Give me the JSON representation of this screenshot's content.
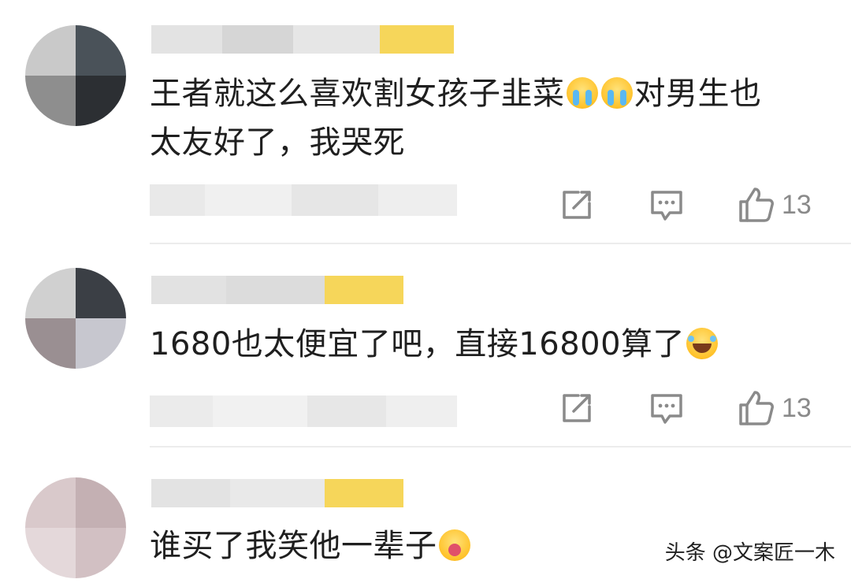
{
  "comments": [
    {
      "text_line1": "王者就这么喜欢割女孩子韭菜",
      "text_line1_tail": "对男生也",
      "text_line2": "太友好了，我哭死",
      "like_count": "13",
      "emojis": [
        "crying-face-icon",
        "crying-face-icon"
      ]
    },
    {
      "text_line1": "1680也太便宜了吧，直接16800算了",
      "like_count": "13",
      "emojis": [
        "laughing-tears-icon"
      ]
    },
    {
      "text_line1": "谁买了我笑他一辈子",
      "emojis": [
        "shouting-laugh-icon"
      ]
    }
  ],
  "watermark": "头条 @文案匠一木",
  "colors": {
    "text": "#1f1f1f",
    "icon": "#8a8a8a",
    "divider": "#ececec",
    "vip_badge": "#f9d23f"
  }
}
